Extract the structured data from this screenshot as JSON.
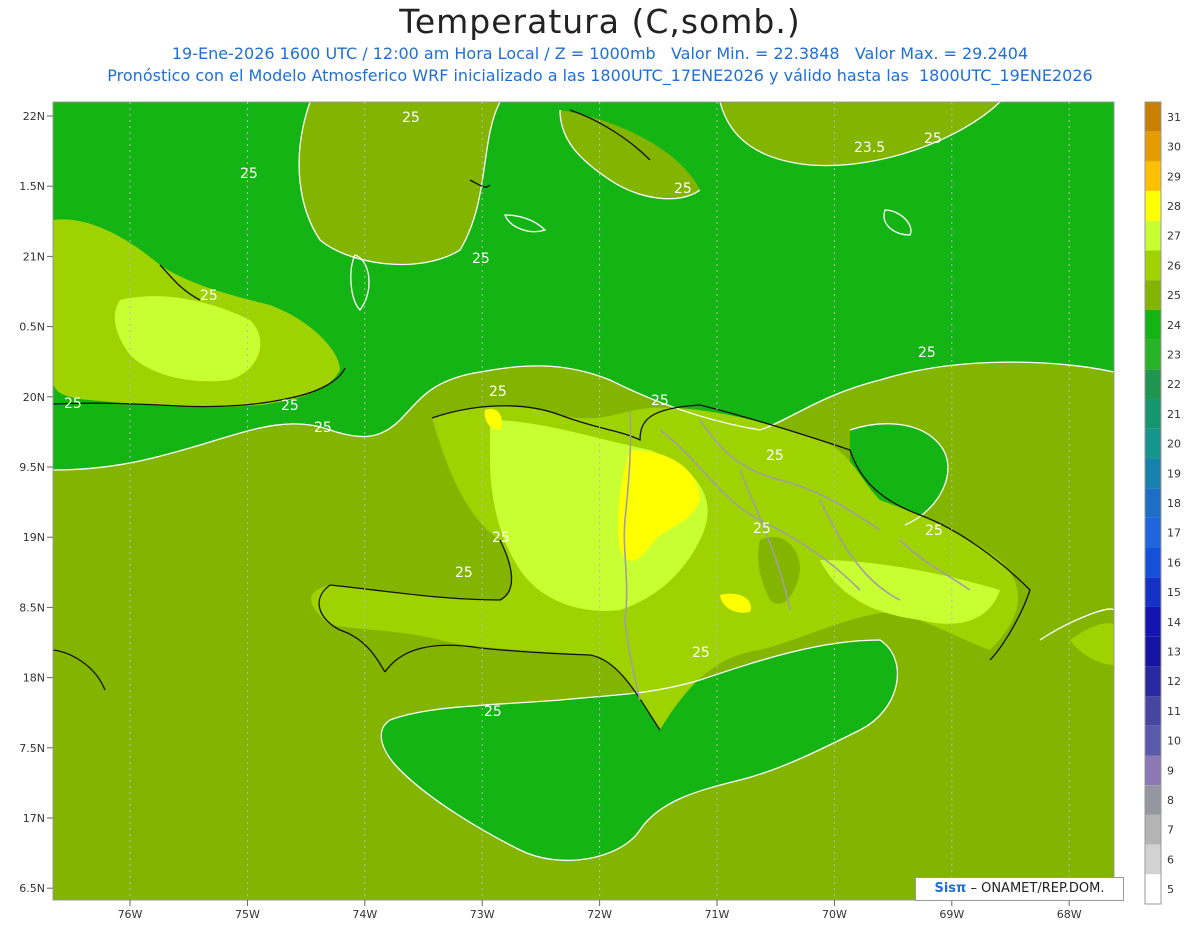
{
  "header": {
    "title": "Temperatura (C,somb.)",
    "subtitle1": "19-Ene-2026 1600 UTC / 12:00 am Hora Local / Z = 1000mb   Valor Min. = 22.3848   Valor Max. = 29.2404",
    "subtitle2": "Pronóstico con el Modelo Atmosferico WRF inicializado a las 1800UTC_17ENE2026 y válido hasta las  1800UTC_19ENE2026"
  },
  "map": {
    "lat_labels": [
      "22N",
      "1.5N",
      "21N",
      "0.5N",
      "20N",
      "9.5N",
      "19N",
      "8.5N",
      "18N",
      "7.5N",
      "17N",
      "6.5N"
    ],
    "lon_labels": [
      "76W",
      "75W",
      "74W",
      "73W",
      "72W",
      "71W",
      "70W",
      "69W",
      "68W"
    ],
    "contour_labels": [
      "25",
      "25",
      "25",
      "25",
      "25",
      "25",
      "25",
      "25",
      "25",
      "25",
      "25",
      "25",
      "25",
      "25",
      "25",
      "25",
      "25",
      "25",
      "25",
      "23.5"
    ]
  },
  "colorbar": {
    "labels": [
      "31",
      "30",
      "29",
      "28",
      "27",
      "26",
      "25",
      "24",
      "23",
      "22",
      "21",
      "20",
      "19",
      "18",
      "17",
      "16",
      "15",
      "14",
      "13",
      "12",
      "11",
      "10",
      "9",
      "8",
      "7",
      "6",
      "5"
    ],
    "colors": [
      "#c88000",
      "#e69c00",
      "#ffc000",
      "#ffff00",
      "#c8ff32",
      "#9ed200",
      "#82b400",
      "#14b414",
      "#28b428",
      "#1e9650",
      "#14966e",
      "#14968c",
      "#1482aa",
      "#1e6ec8",
      "#1e64dc",
      "#1450dc",
      "#1432c8",
      "#1414b4",
      "#1414a0",
      "#2828a0",
      "#4646a0",
      "#5a5aaa",
      "#8c78b4",
      "#9696a0",
      "#b4b4b4",
      "#d2d2d2",
      "#ffffff"
    ]
  },
  "credit": {
    "logo": "Sisπ",
    "text": "– ONAMET/REP.DOM."
  }
}
